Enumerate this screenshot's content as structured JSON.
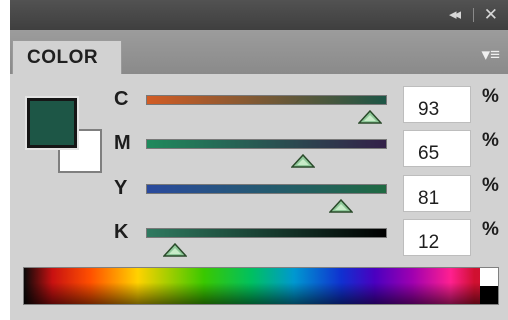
{
  "panel": {
    "title_buttons": {
      "collapse_glyph": "◂◂",
      "close_glyph": "✕"
    },
    "tab_label": "COLOR",
    "menu_icon": "▾≡"
  },
  "swatches": {
    "foreground_color": "#1d5646",
    "background_color": "#ffffff"
  },
  "channels": [
    {
      "label": "C",
      "value": "93",
      "unit": "%",
      "level": 0.93,
      "gradient": [
        "#d25c25",
        "#1d5646"
      ]
    },
    {
      "label": "M",
      "value": "65",
      "unit": "%",
      "level": 0.65,
      "gradient": [
        "#1f8a5c",
        "#332048"
      ]
    },
    {
      "label": "Y",
      "value": "81",
      "unit": "%",
      "level": 0.81,
      "gradient": [
        "#2a4a9e",
        "#1f6a42"
      ]
    },
    {
      "label": "K",
      "value": "12",
      "unit": "%",
      "level": 0.12,
      "gradient": [
        "#2f7a60",
        "#000000"
      ]
    }
  ]
}
